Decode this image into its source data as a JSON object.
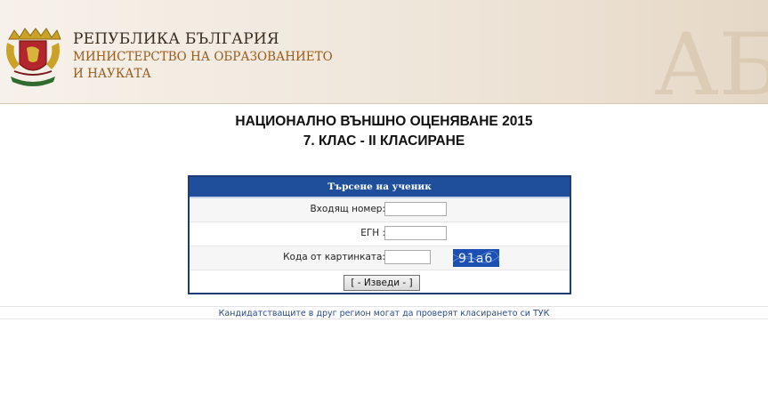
{
  "header": {
    "title": "РЕПУБЛИКА БЪЛГАРИЯ",
    "ministry_line1": "МИНИСТЕРСТВО НА ОБРАЗОВАНИЕТО",
    "ministry_line2": "И НАУКАТА",
    "watermark_letters": "АБ",
    "colors": {
      "title": "#3a2d20",
      "ministry": "#9a5a1a"
    }
  },
  "page": {
    "heading_line1": "НАЦИОНАЛНО ВЪНШНО ОЦЕНЯВАНЕ 2015",
    "heading_line2": "7. КЛАС - II КЛАСИРАНЕ"
  },
  "search_form": {
    "title": "Търсене на ученик",
    "fields": {
      "incoming_number": {
        "label": "Входящ номер:",
        "value": ""
      },
      "egn": {
        "label": "ЕГН :",
        "value": ""
      },
      "captcha_code": {
        "label": "Кода от картинката:",
        "value": ""
      }
    },
    "captcha_text": "91a6",
    "submit_label": "[ - Изведи - ]",
    "colors": {
      "header_bg": "#1f4f9b",
      "border": "#1d3c7a",
      "captcha_bg": "#1b4fb2"
    }
  },
  "footer": {
    "note": "Кандидатстващите в друг регион могат да проверят класирането си ТУК"
  }
}
